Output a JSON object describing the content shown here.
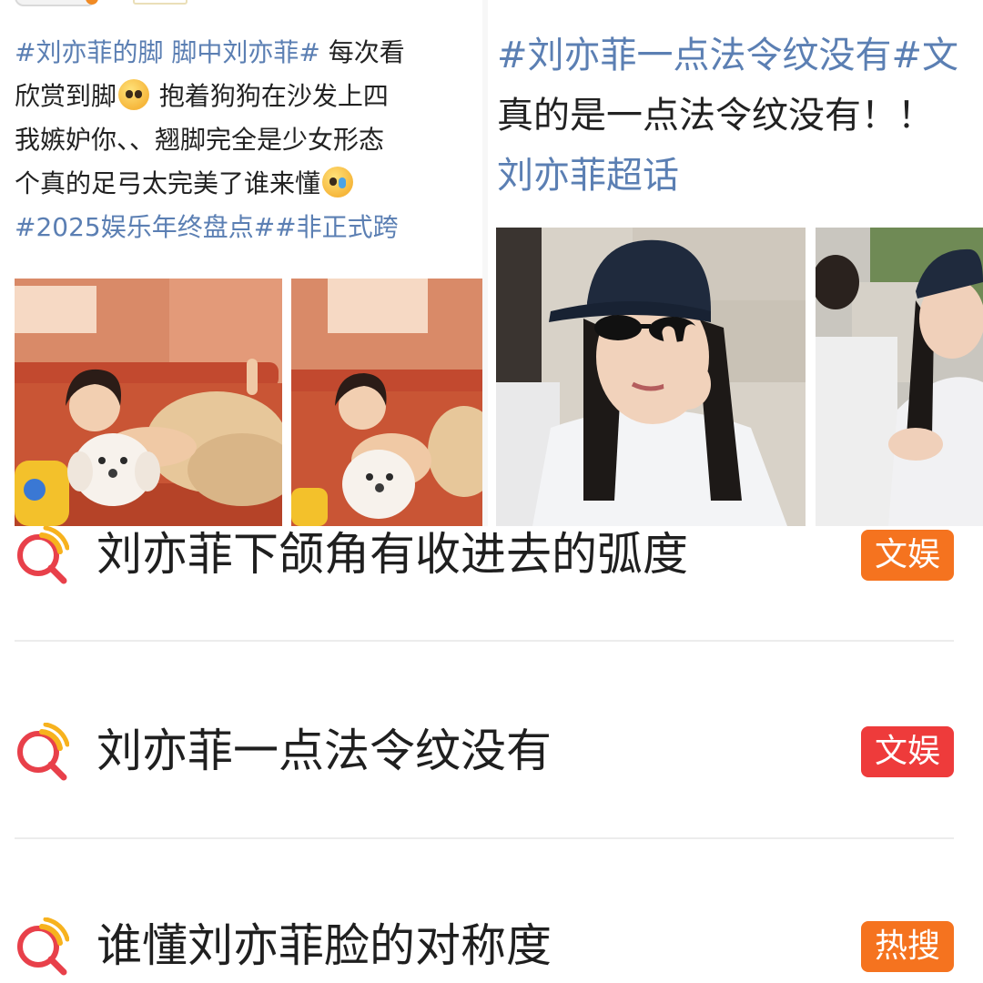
{
  "left_post": {
    "lines": [
      {
        "tags": "#刘亦菲的脚 脚中刘亦菲#",
        "text": " 每次看"
      },
      {
        "text_a": "欣赏到脚",
        "emoji_1": "pleading-face",
        "text_b": " 抱着狗狗在沙发上四"
      },
      {
        "text": "我嫉妒你、、翘脚完全是少女形态"
      },
      {
        "text_a": "个真的足弓太完美了谁来懂",
        "emoji_2": "smiling-tear-face"
      },
      {
        "tags": "#2025娱乐年终盘点##非正式跨"
      }
    ]
  },
  "right_post": {
    "tag_line": "#刘亦菲一点法令纹没有#",
    "tag_line_cut": "文",
    "text_line": "真的是一点法令纹没有！！",
    "super_topic": "刘亦菲超话"
  },
  "hot_search": [
    {
      "term": "刘亦菲下颌角有收进去的弧度",
      "badge": "文娱",
      "badge_color": "#f5731f"
    },
    {
      "term": "刘亦菲一点法令纹没有",
      "badge": "文娱",
      "badge_color": "#ee3b3b"
    },
    {
      "term": "谁懂刘亦菲脸的对称度",
      "badge": "热搜",
      "badge_color": "#f5731f"
    }
  ],
  "colors": {
    "hashtag": "#5b7fb3",
    "icon_red": "#e8404a",
    "icon_yellow": "#f7b21e"
  }
}
